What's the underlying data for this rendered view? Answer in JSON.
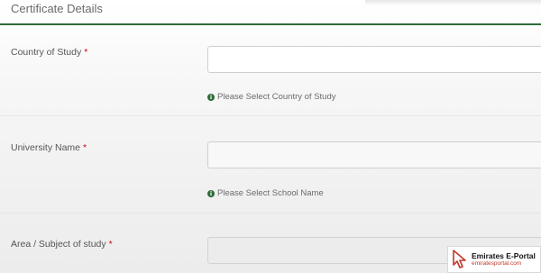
{
  "section": {
    "title": "Certificate Details"
  },
  "fields": [
    {
      "label": "Country of Study",
      "required_mark": "*",
      "value": "",
      "hint": "Please Select Country of Study"
    },
    {
      "label": "University Name",
      "required_mark": "*",
      "value": "",
      "hint": "Please Select School Name"
    },
    {
      "label": "Area / Subject of study",
      "required_mark": "*",
      "value": ""
    }
  ],
  "watermark": {
    "title": "Emirates E-Portal",
    "url": "emiratesportal.com"
  },
  "icons": {
    "hint": "info-icon",
    "watermark_logo": "cursor-logo-icon"
  },
  "colors": {
    "accent_green": "#2e6b3a",
    "required_red": "#d0021b",
    "watermark_red": "#c0392b"
  }
}
